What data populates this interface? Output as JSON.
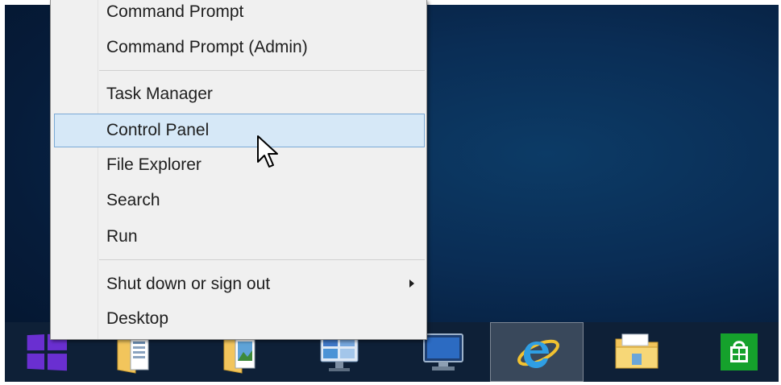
{
  "context_menu": {
    "items": [
      {
        "label": "Command Prompt"
      },
      {
        "label": "Command Prompt (Admin)"
      },
      {
        "label": "Task Manager"
      },
      {
        "label": "Control Panel"
      },
      {
        "label": "File Explorer"
      },
      {
        "label": "Search"
      },
      {
        "label": "Run"
      },
      {
        "label": "Shut down or sign out"
      },
      {
        "label": "Desktop"
      }
    ],
    "hovered_item": "Control Panel"
  },
  "taskbar": {
    "start_button_icon": "windows-logo-icon",
    "pinned": [
      {
        "icon": "folder-document-icon"
      },
      {
        "icon": "folder-pictures-icon"
      },
      {
        "icon": "control-panel-icon"
      },
      {
        "icon": "computer-monitor-icon"
      },
      {
        "icon": "internet-explorer-icon",
        "active": true
      },
      {
        "icon": "file-explorer-icon"
      },
      {
        "icon": "store-icon"
      }
    ]
  },
  "colors": {
    "desktop_bg": "#0a2d55",
    "taskbar_bg": "#0e2037",
    "menu_bg": "#f0f0f0",
    "menu_hover": "#d6e8f7",
    "start_logo": "#6a2fd1",
    "store_green": "#15a12c"
  }
}
